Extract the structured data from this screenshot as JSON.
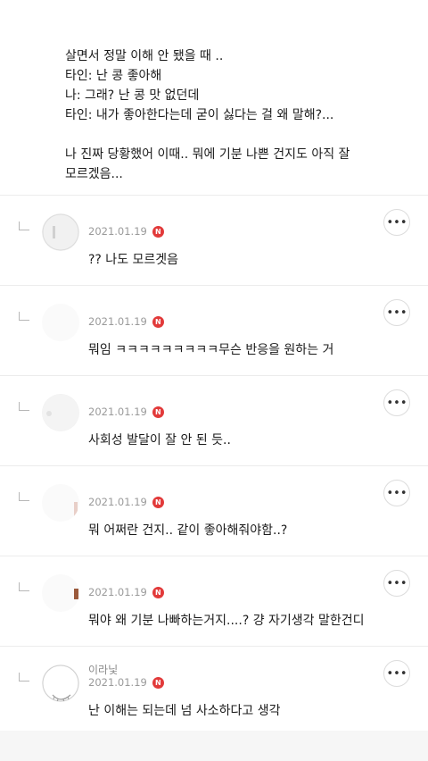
{
  "post": {
    "lines": [
      "살면서 정말 이해 안 됐을 때 ..",
      "타인: 난 콩 좋아해",
      "나: 그래? 난 콩 맛 없던데",
      "타인: 내가 좋아한다는데 굳이 싫다는 걸 왜 말해?...",
      "",
      "나 진짜 당황했어 이때.. 뭐에 기분 나쁜 건지도 아직 잘",
      "모르겠음..."
    ]
  },
  "comments": [
    {
      "nickname": "",
      "date": "2021.01.19",
      "badge": "N",
      "text": "?? 나도 모르겟음"
    },
    {
      "nickname": "",
      "date": "2021.01.19",
      "badge": "N",
      "text": "뭐임 ㅋㅋㅋㅋㅋㅋㅋㅋㅋ무슨 반응을 원하는 거"
    },
    {
      "nickname": "",
      "date": "2021.01.19",
      "badge": "N",
      "text": "사회성 발달이 잘 안 된 듯.."
    },
    {
      "nickname": "",
      "date": "2021.01.19",
      "badge": "N",
      "text": "뭐 어쩌란 건지.. 같이 좋아해줘야함..?"
    },
    {
      "nickname": "",
      "date": "2021.01.19",
      "badge": "N",
      "text": "뭐야 왜 기분 나빠하는거지....? 걍 자기생각 말한건디"
    },
    {
      "nickname": "이라닟",
      "date": "2021.01.19",
      "badge": "N",
      "text": "난 이해는 되는데 넘 사소하다고 생각"
    }
  ],
  "icons": {
    "reply": "reply-arrow-icon",
    "more": "more-options-icon",
    "badge": "new-badge-icon"
  },
  "colors": {
    "badge": "#e23a3a",
    "divider": "#ececec",
    "meta": "#9a9a9a"
  }
}
